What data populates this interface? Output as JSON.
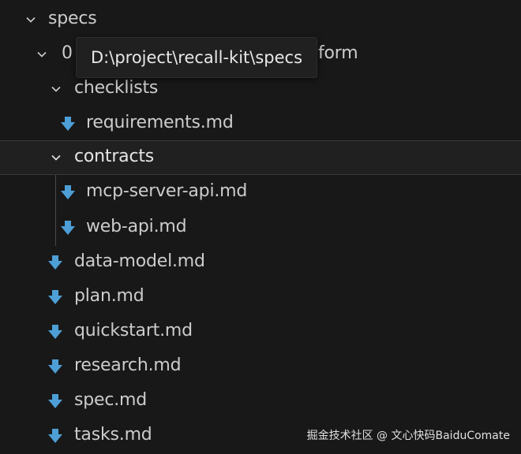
{
  "explorer": {
    "root": {
      "label": "specs",
      "expanded": true
    },
    "feature_folder": {
      "label_prefix": "0",
      "label_suffix": "form",
      "expanded": true
    },
    "checklists": {
      "label": "checklists",
      "expanded": true
    },
    "requirements": {
      "label": "requirements.md"
    },
    "contracts": {
      "label": "contracts",
      "expanded": true,
      "selected": true
    },
    "mcp_server_api": {
      "label": "mcp-server-api.md"
    },
    "web_api": {
      "label": "web-api.md"
    },
    "files": [
      {
        "label": "data-model.md"
      },
      {
        "label": "plan.md"
      },
      {
        "label": "quickstart.md"
      },
      {
        "label": "research.md"
      },
      {
        "label": "spec.md"
      },
      {
        "label": "tasks.md"
      }
    ]
  },
  "tooltip": {
    "text": "D:\\project\\recall-kit\\specs"
  },
  "watermark": {
    "text": "掘金技术社区 @ 文心快码BaiduComate"
  },
  "icons": {
    "chevron": "chevron-down-icon",
    "markdown_file": "markdown-download-icon"
  },
  "colors": {
    "background": "#181818",
    "text": "#cccccc",
    "file_icon": "#4d9fd6",
    "selected_row": "#202020"
  }
}
